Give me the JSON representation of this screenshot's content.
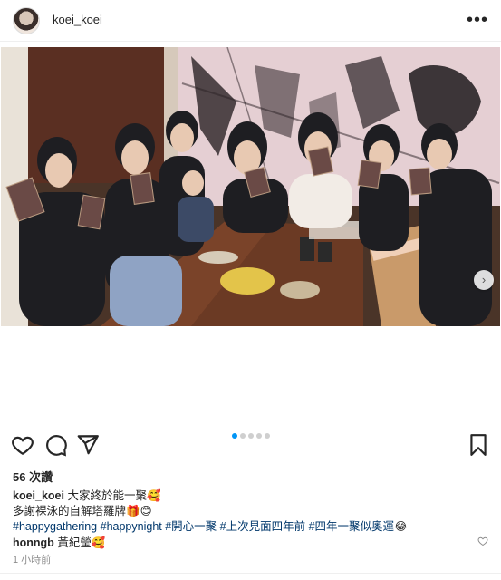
{
  "header": {
    "username": "koei_koei",
    "more_icon": "more-horizontal-icon",
    "more_label": "•••"
  },
  "post": {
    "image_alt": "group photo",
    "next_icon": "chevron-right-icon",
    "next_label": "›",
    "carousel": {
      "count": 5,
      "active_index": 0
    }
  },
  "actions": {
    "like_icon": "heart-icon",
    "comment_icon": "comment-icon",
    "share_icon": "paper-plane-icon",
    "save_icon": "bookmark-icon"
  },
  "likes": "56 次讚",
  "caption": {
    "username": "koei_koei",
    "line1": "大家終於能一聚🥰",
    "line2": "多謝裸泳的自解塔羅牌🎁😊",
    "hashtags": [
      "#happygathering",
      "#happynight",
      "#開心一聚",
      "#上次見面四年前",
      "#四年一聚似奧運"
    ],
    "hashtags_emoji": "😂"
  },
  "comment": {
    "username": "honngb",
    "text": "黃紀瑩🥰"
  },
  "timestamp": "1 小時前",
  "colors": {
    "accent": "#0095f6",
    "hashtag": "#00376b",
    "muted": "#8e8e8e"
  }
}
